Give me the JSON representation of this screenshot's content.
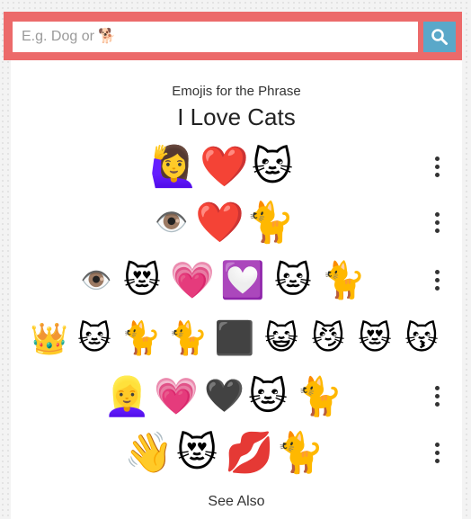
{
  "search": {
    "placeholder": "E.g. Dog or 🐕"
  },
  "header": {
    "subtitle": "Emojis for the Phrase",
    "title": "I Love Cats"
  },
  "rows": [
    {
      "emojis": [
        "🙋‍♀️",
        "❤️",
        "🐱"
      ]
    },
    {
      "emojis": [
        "👁️",
        "❤️",
        "🐈"
      ]
    },
    {
      "emojis": [
        "👁️",
        "😻",
        "💗",
        "💟",
        "🐱",
        "🐈"
      ]
    },
    {
      "emojis": [
        "👑",
        "🐱",
        "🐈",
        "🐈",
        "⬛",
        "😺",
        "😼",
        "😻",
        "😽"
      ]
    },
    {
      "emojis": [
        "👱‍♀️",
        "💗",
        "🖤",
        "🐱",
        "🐈"
      ]
    },
    {
      "emojis": [
        "👋",
        "😻",
        "💋",
        "🐈"
      ]
    }
  ],
  "footer": {
    "see_also": "See Also"
  },
  "icons": {
    "search": "search-icon",
    "more": "more-vertical-icon"
  },
  "colors": {
    "search_bar": "#ec6a6a",
    "search_button": "#5aa8c9"
  }
}
